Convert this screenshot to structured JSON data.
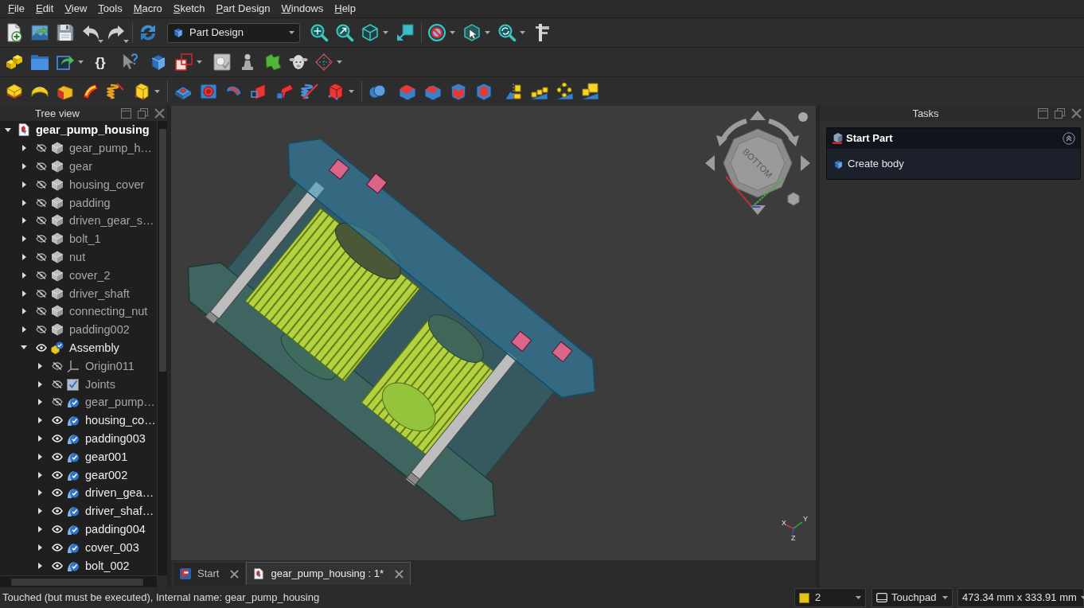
{
  "menu": [
    "File",
    "Edit",
    "View",
    "Tools",
    "Macro",
    "Sketch",
    "Part Design",
    "Windows",
    "Help"
  ],
  "workbench": {
    "label": "Part Design"
  },
  "braces_button": "{}",
  "tree_view": {
    "title": "Tree view",
    "root": {
      "label": "gear_pump_housing",
      "kind": "document",
      "expanded": true,
      "children": [
        {
          "label": "gear_pump_h…",
          "kind": "part",
          "visible": false,
          "expanded": false
        },
        {
          "label": "gear",
          "kind": "part",
          "visible": false,
          "expanded": false
        },
        {
          "label": "housing_cover",
          "kind": "part",
          "visible": false,
          "expanded": false
        },
        {
          "label": "padding",
          "kind": "part",
          "visible": false,
          "expanded": false
        },
        {
          "label": "driven_gear_s…",
          "kind": "part",
          "visible": false,
          "expanded": false
        },
        {
          "label": "bolt_1",
          "kind": "part",
          "visible": false,
          "expanded": false
        },
        {
          "label": "nut",
          "kind": "part",
          "visible": false,
          "expanded": false
        },
        {
          "label": "cover_2",
          "kind": "part",
          "visible": false,
          "expanded": false
        },
        {
          "label": "driver_shaft",
          "kind": "part",
          "visible": false,
          "expanded": false
        },
        {
          "label": "connecting_nut",
          "kind": "part",
          "visible": false,
          "expanded": false
        },
        {
          "label": "padding002",
          "kind": "part",
          "visible": false,
          "expanded": false
        },
        {
          "label": "Assembly",
          "kind": "assembly",
          "visible": true,
          "expanded": true,
          "children": [
            {
              "label": "Origin011",
              "kind": "origin",
              "visible": false,
              "expanded": false
            },
            {
              "label": "Joints",
              "kind": "joints",
              "visible": false,
              "expanded": false
            },
            {
              "label": "gear_pump…",
              "kind": "link",
              "visible": false,
              "expanded": false
            },
            {
              "label": "housing_co…",
              "kind": "link",
              "visible": true,
              "expanded": false
            },
            {
              "label": "padding003",
              "kind": "link",
              "visible": true,
              "expanded": false
            },
            {
              "label": "gear001",
              "kind": "link",
              "visible": true,
              "expanded": false
            },
            {
              "label": "gear002",
              "kind": "link",
              "visible": true,
              "expanded": false
            },
            {
              "label": "driven_gea…",
              "kind": "link",
              "visible": true,
              "expanded": false
            },
            {
              "label": "driver_shaf…",
              "kind": "link",
              "visible": true,
              "expanded": false
            },
            {
              "label": "padding004",
              "kind": "link",
              "visible": true,
              "expanded": false
            },
            {
              "label": "cover_003",
              "kind": "link",
              "visible": true,
              "expanded": false
            },
            {
              "label": "bolt_002",
              "kind": "link",
              "visible": true,
              "expanded": false
            }
          ]
        }
      ]
    }
  },
  "viewport": {
    "nav_cube_face": "BOTTOM",
    "axes": [
      {
        "label": "X",
        "color": "#d03030"
      },
      {
        "label": "Y",
        "color": "#3cb043"
      },
      {
        "label": "Z",
        "color": "#3050d0"
      }
    ]
  },
  "document_tabs": [
    {
      "label": "Start",
      "kind": "start",
      "selected": false
    },
    {
      "label": "gear_pump_housing : 1*",
      "kind": "document",
      "selected": true
    }
  ],
  "tasks": {
    "title": "Tasks",
    "panel": {
      "title": "Start Part",
      "expanded": true,
      "actions": [
        "Create body"
      ]
    }
  },
  "status_bar": {
    "message": "Touched (but must be executed), Internal name: gear_pump_housing",
    "dropdown_1": "2",
    "navigation_style": "Touchpad",
    "dimensions": "473.34 mm x 333.91 mm"
  }
}
